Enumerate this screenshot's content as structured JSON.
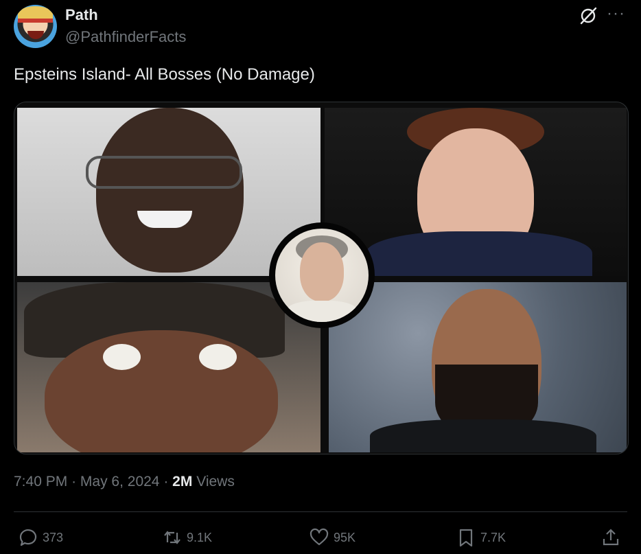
{
  "author": {
    "display_name": "Path",
    "handle": "@PathfinderFacts",
    "avatar_icon": "avatar-icon"
  },
  "header_icons": [
    "grok-icon",
    "more-icon"
  ],
  "tweet": {
    "text": "Epsteins Island- All Bosses (No Damage)",
    "media_icon": "collage-image"
  },
  "meta": {
    "time": "7:40 PM",
    "sep1": "·",
    "date": "May 6, 2024",
    "sep2": "·",
    "views_count": "2M",
    "views_label": "Views"
  },
  "actions": {
    "reply": {
      "icon": "reply-icon",
      "count": "373"
    },
    "repost": {
      "icon": "repost-icon",
      "count": "9.1K"
    },
    "like": {
      "icon": "heart-icon",
      "count": "95K"
    },
    "bookmark": {
      "icon": "bookmark-icon",
      "count": "7.7K"
    },
    "share": {
      "icon": "share-icon"
    }
  },
  "colors": {
    "background": "#000000",
    "text_primary": "#e7e9ea",
    "text_secondary": "#71767b",
    "divider": "#2f3336"
  }
}
